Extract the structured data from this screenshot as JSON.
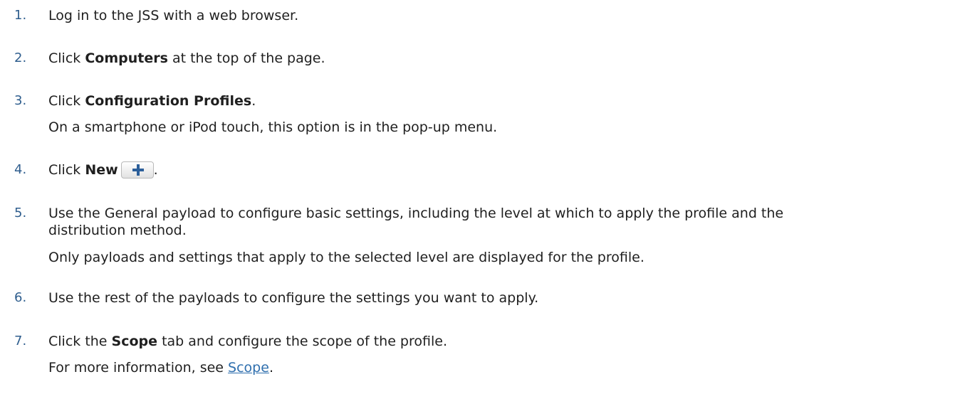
{
  "steps": [
    {
      "number": "1.",
      "text": "Log in to the JSS with a web browser."
    },
    {
      "number": "2.",
      "pre": "Click ",
      "bold": "Computers",
      "post": " at the top of the page."
    },
    {
      "number": "3.",
      "pre": "Click ",
      "bold": "Configuration Profiles",
      "post": ".",
      "note": "On a smartphone or iPod touch, this option is in the pop-up menu."
    },
    {
      "number": "4.",
      "pre": "Click ",
      "bold": "New",
      "post": ".",
      "icon": "plus-icon"
    },
    {
      "number": "5.",
      "text": "Use the General payload to configure basic settings, including the level at which to apply the profile and the distribution method.",
      "note": "Only payloads and settings that apply to the selected level are displayed for the profile."
    },
    {
      "number": "6.",
      "text": "Use the rest of the payloads to configure the settings you want to apply."
    },
    {
      "number": "7.",
      "pre": "Click the ",
      "bold": "Scope",
      "post": " tab and configure the scope of the profile.",
      "note_pre": "For more information, see ",
      "note_link": "Scope",
      "note_post": "."
    }
  ],
  "colors": {
    "number": "#2f5e8e",
    "text": "#1f1f1f",
    "link": "#2f6fae",
    "plus_icon": "#2c5f9a"
  }
}
